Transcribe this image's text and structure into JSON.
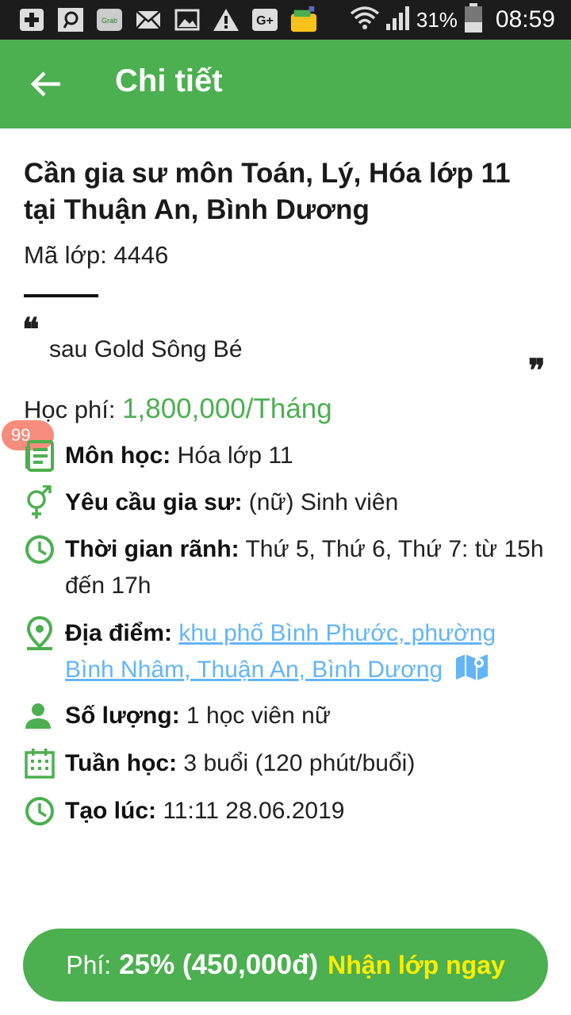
{
  "status_bar": {
    "icons": [
      "plus-icon",
      "search-app-icon",
      "grab-icon",
      "mail-icon",
      "image-icon",
      "warning-icon",
      "google-plus-icon",
      "wallet-icon"
    ],
    "grab_label": "Grab",
    "gplus_label": "G+",
    "battery_percent": "31%",
    "time": "08:59"
  },
  "app_bar": {
    "title": "Chi tiết"
  },
  "listing": {
    "title": "Cần gia sư môn Toán, Lý, Hóa lớp 11 tại Thuận An, Bình Dương",
    "code_label": "Mã lớp: ",
    "code_value": "4446",
    "quote": "sau Gold Sông Bé",
    "fee_label": "Học phí: ",
    "fee_value": "1,800,000/Tháng",
    "badge": "99"
  },
  "details": {
    "subject_label": "Môn học:",
    "subject_value": " Hóa lớp 11",
    "tutor_label": "Yêu cầu gia sư:",
    "tutor_value": " (nữ) Sinh viên",
    "time_label": "Thời gian rãnh:",
    "time_value": " Thứ 5, Thứ 6, Thứ 7: từ 15h đến 17h",
    "location_label": "Địa điểm:",
    "location_value": "khu phố Bình Phước, phường Bình Nhâm, Thuận An, Bình Dương",
    "quantity_label": "Số lượng:",
    "quantity_value": " 1 học viên nữ",
    "week_label": "Tuần học:",
    "week_value": " 3 buổi (120 phút/buổi)",
    "created_label": "Tạo lúc:",
    "created_value": " 11:11 28.06.2019"
  },
  "action": {
    "fee_prefix": "Phí:",
    "fee_amount": "25% (450,000đ)",
    "cta": "Nhận lớp ngay"
  },
  "colors": {
    "primary": "#4caf50",
    "link": "#64b5f6",
    "cta_text": "#ffee00"
  }
}
